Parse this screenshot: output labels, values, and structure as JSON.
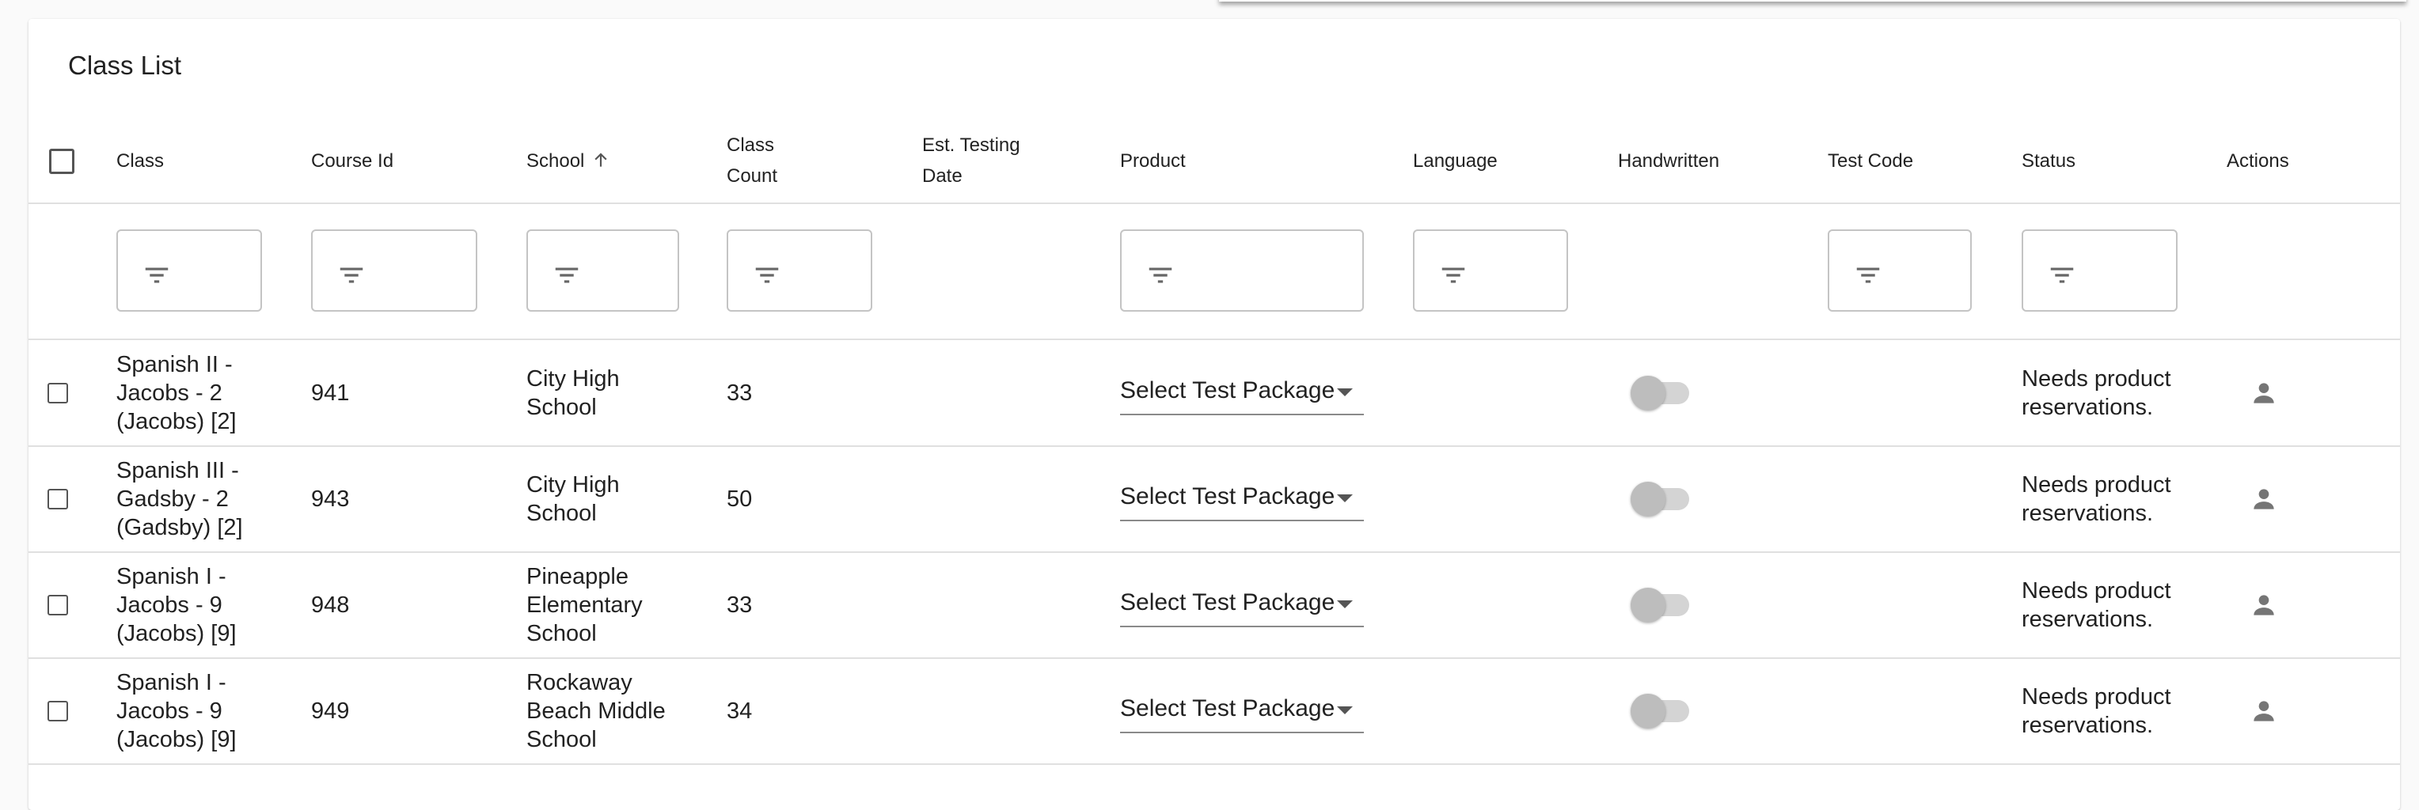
{
  "card": {
    "title": "Class List"
  },
  "columns": {
    "class": "Class",
    "course_id": "Course Id",
    "school": "School",
    "class_count_line1": "Class",
    "class_count_line2": "Count",
    "est_testing_line1": "Est. Testing",
    "est_testing_line2": "Date",
    "product": "Product",
    "language": "Language",
    "handwritten": "Handwritten",
    "test_code": "Test Code",
    "status": "Status",
    "actions": "Actions"
  },
  "sort": {
    "column": "School",
    "direction": "ascending",
    "icon": "arrow-up-icon"
  },
  "filters": {
    "icon": "filter-list-icon",
    "columns": [
      "Class",
      "Course Id",
      "School",
      "Class Count",
      "Product",
      "Language",
      "Test Code",
      "Status"
    ]
  },
  "rows": [
    {
      "class_lines": [
        "Spanish II -",
        "Jacobs - 2",
        "(Jacobs) [2]"
      ],
      "course_id": "941",
      "school_lines": [
        "City High",
        "School"
      ],
      "class_count": "33",
      "product": "Select Test Package",
      "handwritten": false,
      "status_lines": [
        "Needs product",
        "reservations."
      ],
      "action_icon": "person-icon"
    },
    {
      "class_lines": [
        "Spanish III -",
        "Gadsby - 2",
        "(Gadsby) [2]"
      ],
      "course_id": "943",
      "school_lines": [
        "City High",
        "School"
      ],
      "class_count": "50",
      "product": "Select Test Package",
      "handwritten": false,
      "status_lines": [
        "Needs product",
        "reservations."
      ],
      "action_icon": "person-icon"
    },
    {
      "class_lines": [
        "Spanish I -",
        "Jacobs - 9",
        "(Jacobs) [9]"
      ],
      "course_id": "948",
      "school_lines": [
        "Pineapple",
        "Elementary",
        "School"
      ],
      "class_count": "33",
      "product": "Select Test Package",
      "handwritten": false,
      "status_lines": [
        "Needs product",
        "reservations."
      ],
      "action_icon": "person-icon"
    },
    {
      "class_lines": [
        "Spanish I -",
        "Jacobs - 9",
        "(Jacobs) [9]"
      ],
      "course_id": "949",
      "school_lines": [
        "Rockaway",
        "Beach Middle",
        "School"
      ],
      "class_count": "34",
      "product": "Select Test Package",
      "handwritten": false,
      "status_lines": [
        "Needs product",
        "reservations."
      ],
      "action_icon": "person-icon"
    }
  ]
}
